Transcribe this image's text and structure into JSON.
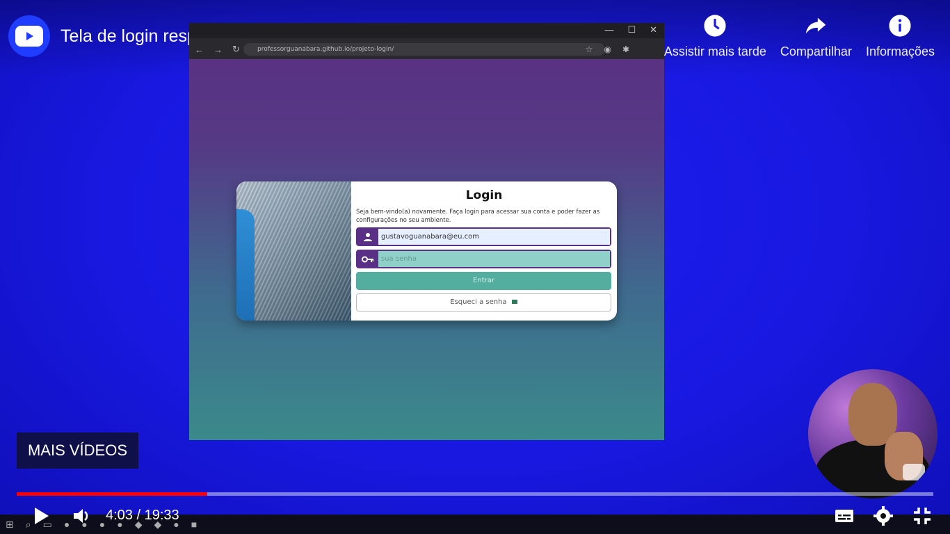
{
  "header": {
    "title": "Tela de login responsiva só com HTML e CSS - @Curso em Vídeo ...",
    "actions": [
      {
        "label": "Assistir mais tarde",
        "icon": "clock-icon"
      },
      {
        "label": "Compartilhar",
        "icon": "share-icon"
      },
      {
        "label": "Informações",
        "icon": "info-icon"
      }
    ]
  },
  "recording": {
    "url": "professorguanabara.github.io/projeto-login/",
    "login": {
      "title": "Login",
      "subtitle": "Seja bem-vindo(a) novamente. Faça login para acessar sua conta e poder fazer as configurações no seu ambiente.",
      "email_value": "gustavoguanabara@eu.com",
      "password_placeholder": "sua senha",
      "submit_label": "Entrar",
      "forgot_label": "Esqueci a senha"
    }
  },
  "mais_videos": "MAIS VÍDEOS",
  "player": {
    "time_display": "4:03 / 19:33",
    "progress_fraction": 0.208,
    "colors": {
      "played": "#ff0000",
      "background": "#1818e0"
    }
  }
}
